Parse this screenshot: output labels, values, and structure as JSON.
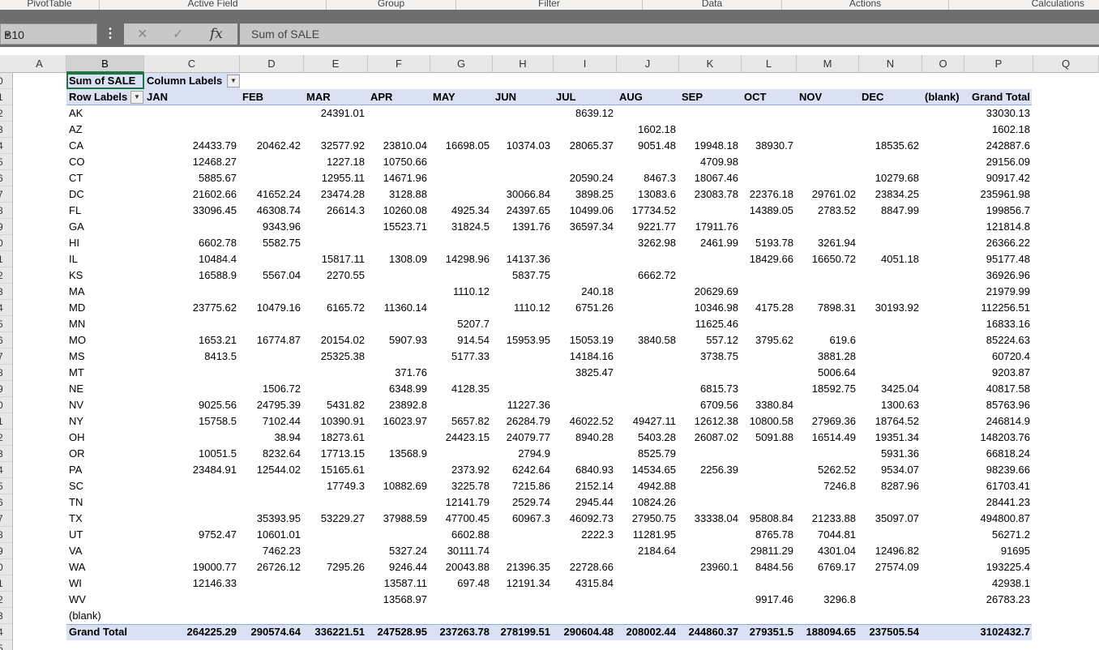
{
  "ribbon": {
    "groups": [
      "PivotTable",
      "Active Field",
      "Group",
      "Filter",
      "Data",
      "Actions",
      "Calculations"
    ]
  },
  "formula_bar": {
    "name_box": "B10",
    "formula": "Sum of SALE"
  },
  "columns": [
    "A",
    "B",
    "C",
    "D",
    "E",
    "F",
    "G",
    "H",
    "I",
    "J",
    "K",
    "L",
    "M",
    "N",
    "O",
    "P",
    "Q"
  ],
  "row_numbers": [
    "0",
    "1",
    "2",
    "3",
    "4",
    "5",
    "6",
    "7",
    "8",
    "9",
    "0",
    "1",
    "2",
    "3",
    "4",
    "5",
    "6",
    "7",
    "8",
    "9",
    "0",
    "1",
    "2",
    "3",
    "4",
    "5",
    "6",
    "7",
    "8",
    "9",
    "0",
    "1",
    "2",
    "3",
    "4",
    "5"
  ],
  "pivot": {
    "corner_label": "Sum of SALE",
    "column_labels": "Column Labels",
    "row_labels": "Row Labels",
    "month_headers": [
      "JAN",
      "FEB",
      "MAR",
      "APR",
      "MAY",
      "JUN",
      "JUL",
      "AUG",
      "SEP",
      "OCT",
      "NOV",
      "DEC",
      "(blank)",
      "Grand Total"
    ],
    "rows": [
      {
        "label": "AK",
        "values": [
          "",
          "",
          "24391.01",
          "",
          "",
          "",
          "8639.12",
          "",
          "",
          "",
          "",
          "",
          "",
          "33030.13"
        ]
      },
      {
        "label": "AZ",
        "values": [
          "",
          "",
          "",
          "",
          "",
          "",
          "",
          "1602.18",
          "",
          "",
          "",
          "",
          "",
          "1602.18"
        ]
      },
      {
        "label": "CA",
        "values": [
          "24433.79",
          "20462.42",
          "32577.92",
          "23810.04",
          "16698.05",
          "10374.03",
          "28065.37",
          "9051.48",
          "19948.18",
          "38930.7",
          "",
          "18535.62",
          "",
          "242887.6"
        ]
      },
      {
        "label": "CO",
        "values": [
          "12468.27",
          "",
          "1227.18",
          "10750.66",
          "",
          "",
          "",
          "",
          "4709.98",
          "",
          "",
          "",
          "",
          "29156.09"
        ]
      },
      {
        "label": "CT",
        "values": [
          "5885.67",
          "",
          "12955.11",
          "14671.96",
          "",
          "",
          "20590.24",
          "8467.3",
          "18067.46",
          "",
          "",
          "10279.68",
          "",
          "90917.42"
        ]
      },
      {
        "label": "DC",
        "values": [
          "21602.66",
          "41652.24",
          "23474.28",
          "3128.88",
          "",
          "30066.84",
          "3898.25",
          "13083.6",
          "23083.78",
          "22376.18",
          "29761.02",
          "23834.25",
          "",
          "235961.98"
        ]
      },
      {
        "label": "FL",
        "values": [
          "33096.45",
          "46308.74",
          "26614.3",
          "10260.08",
          "4925.34",
          "24397.65",
          "10499.06",
          "17734.52",
          "",
          "14389.05",
          "2783.52",
          "8847.99",
          "",
          "199856.7"
        ]
      },
      {
        "label": "GA",
        "values": [
          "",
          "9343.96",
          "",
          "15523.71",
          "31824.5",
          "1391.76",
          "36597.34",
          "9221.77",
          "17911.76",
          "",
          "",
          "",
          "",
          "121814.8"
        ]
      },
      {
        "label": "HI",
        "values": [
          "6602.78",
          "5582.75",
          "",
          "",
          "",
          "",
          "",
          "3262.98",
          "2461.99",
          "5193.78",
          "3261.94",
          "",
          "",
          "26366.22"
        ]
      },
      {
        "label": "IL",
        "values": [
          "10484.4",
          "",
          "15817.11",
          "1308.09",
          "14298.96",
          "14137.36",
          "",
          "",
          "",
          "18429.66",
          "16650.72",
          "4051.18",
          "",
          "95177.48"
        ]
      },
      {
        "label": "KS",
        "values": [
          "16588.9",
          "5567.04",
          "2270.55",
          "",
          "",
          "5837.75",
          "",
          "6662.72",
          "",
          "",
          "",
          "",
          "",
          "36926.96"
        ]
      },
      {
        "label": "MA",
        "values": [
          "",
          "",
          "",
          "",
          "1110.12",
          "",
          "240.18",
          "",
          "20629.69",
          "",
          "",
          "",
          "",
          "21979.99"
        ]
      },
      {
        "label": "MD",
        "values": [
          "23775.62",
          "10479.16",
          "6165.72",
          "11360.14",
          "",
          "1110.12",
          "6751.26",
          "",
          "10346.98",
          "4175.28",
          "7898.31",
          "30193.92",
          "",
          "112256.51"
        ]
      },
      {
        "label": "MN",
        "values": [
          "",
          "",
          "",
          "",
          "5207.7",
          "",
          "",
          "",
          "11625.46",
          "",
          "",
          "",
          "",
          "16833.16"
        ]
      },
      {
        "label": "MO",
        "values": [
          "1653.21",
          "16774.87",
          "20154.02",
          "5907.93",
          "914.54",
          "15953.95",
          "15053.19",
          "3840.58",
          "557.12",
          "3795.62",
          "619.6",
          "",
          "",
          "85224.63"
        ]
      },
      {
        "label": "MS",
        "values": [
          "8413.5",
          "",
          "25325.38",
          "",
          "5177.33",
          "",
          "14184.16",
          "",
          "3738.75",
          "",
          "3881.28",
          "",
          "",
          "60720.4"
        ]
      },
      {
        "label": "MT",
        "values": [
          "",
          "",
          "",
          "371.76",
          "",
          "",
          "3825.47",
          "",
          "",
          "",
          "5006.64",
          "",
          "",
          "9203.87"
        ]
      },
      {
        "label": "NE",
        "values": [
          "",
          "1506.72",
          "",
          "6348.99",
          "4128.35",
          "",
          "",
          "",
          "6815.73",
          "",
          "18592.75",
          "3425.04",
          "",
          "40817.58"
        ]
      },
      {
        "label": "NV",
        "values": [
          "9025.56",
          "24795.39",
          "5431.82",
          "23892.8",
          "",
          "11227.36",
          "",
          "",
          "6709.56",
          "3380.84",
          "",
          "1300.63",
          "",
          "85763.96"
        ]
      },
      {
        "label": "NY",
        "values": [
          "15758.5",
          "7102.44",
          "10390.91",
          "16023.97",
          "5657.82",
          "26284.79",
          "46022.52",
          "49427.11",
          "12612.38",
          "10800.58",
          "27969.36",
          "18764.52",
          "",
          "246814.9"
        ]
      },
      {
        "label": "OH",
        "values": [
          "",
          "38.94",
          "18273.61",
          "",
          "24423.15",
          "24079.77",
          "8940.28",
          "5403.28",
          "26087.02",
          "5091.88",
          "16514.49",
          "19351.34",
          "",
          "148203.76"
        ]
      },
      {
        "label": "OR",
        "values": [
          "10051.5",
          "8232.64",
          "17713.15",
          "13568.9",
          "",
          "2794.9",
          "",
          "8525.79",
          "",
          "",
          "",
          "5931.36",
          "",
          "66818.24"
        ]
      },
      {
        "label": "PA",
        "values": [
          "23484.91",
          "12544.02",
          "15165.61",
          "",
          "2373.92",
          "6242.64",
          "6840.93",
          "14534.65",
          "2256.39",
          "",
          "5262.52",
          "9534.07",
          "",
          "98239.66"
        ]
      },
      {
        "label": "SC",
        "values": [
          "",
          "",
          "17749.3",
          "10882.69",
          "3225.78",
          "7215.86",
          "2152.14",
          "4942.88",
          "",
          "",
          "7246.8",
          "8287.96",
          "",
          "61703.41"
        ]
      },
      {
        "label": "TN",
        "values": [
          "",
          "",
          "",
          "",
          "12141.79",
          "2529.74",
          "2945.44",
          "10824.26",
          "",
          "",
          "",
          "",
          "",
          "28441.23"
        ]
      },
      {
        "label": "TX",
        "values": [
          "",
          "35393.95",
          "53229.27",
          "37988.59",
          "47700.45",
          "60967.3",
          "46092.73",
          "27950.75",
          "33338.04",
          "95808.84",
          "21233.88",
          "35097.07",
          "",
          "494800.87"
        ]
      },
      {
        "label": "UT",
        "values": [
          "9752.47",
          "10601.01",
          "",
          "",
          "6602.88",
          "",
          "2222.3",
          "11281.95",
          "",
          "8765.78",
          "7044.81",
          "",
          "",
          "56271.2"
        ]
      },
      {
        "label": "VA",
        "values": [
          "",
          "7462.23",
          "",
          "5327.24",
          "30111.74",
          "",
          "",
          "2184.64",
          "",
          "29811.29",
          "4301.04",
          "12496.82",
          "",
          "91695"
        ]
      },
      {
        "label": "WA",
        "values": [
          "19000.77",
          "26726.12",
          "7295.26",
          "9246.44",
          "20043.88",
          "21396.35",
          "22728.66",
          "",
          "23960.1",
          "8484.56",
          "6769.17",
          "27574.09",
          "",
          "193225.4"
        ]
      },
      {
        "label": "WI",
        "values": [
          "12146.33",
          "",
          "",
          "13587.11",
          "697.48",
          "12191.34",
          "4315.84",
          "",
          "",
          "",
          "",
          "",
          "",
          "42938.1"
        ]
      },
      {
        "label": "WV",
        "values": [
          "",
          "",
          "",
          "13568.97",
          "",
          "",
          "",
          "",
          "",
          "9917.46",
          "3296.8",
          "",
          "",
          "26783.23"
        ]
      },
      {
        "label": "(blank)",
        "values": [
          "",
          "",
          "",
          "",
          "",
          "",
          "",
          "",
          "",
          "",
          "",
          "",
          "",
          ""
        ]
      }
    ],
    "grand_total": {
      "label": "Grand Total",
      "values": [
        "264225.29",
        "290574.64",
        "336221.51",
        "247528.95",
        "237263.78",
        "278199.51",
        "290604.48",
        "208002.44",
        "244860.37",
        "279351.5",
        "188094.65",
        "237505.54",
        "",
        "3102432.7"
      ]
    }
  },
  "colors": {
    "pivot_header_band": "#d9e1f2",
    "selection": "#217346",
    "formula_bar_bg": "#6e6e6e"
  }
}
